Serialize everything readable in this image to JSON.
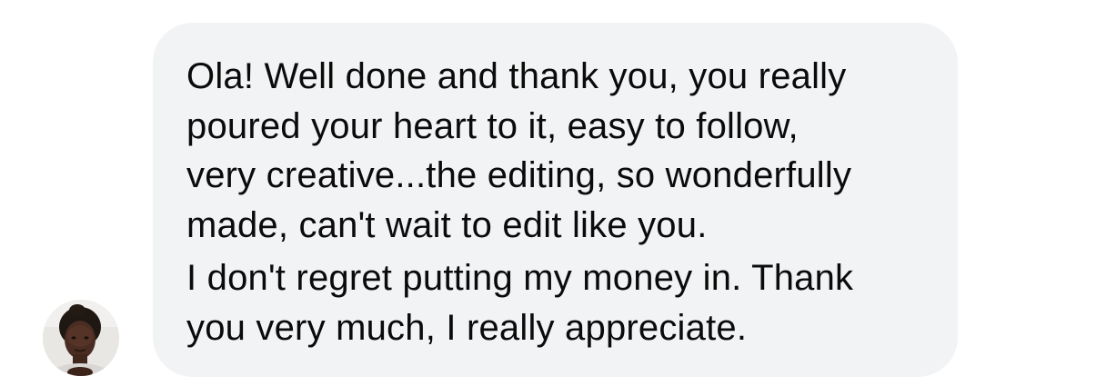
{
  "message": {
    "paragraphs": [
      "Ola! Well done and thank you, you really\npoured your heart to it, easy to follow,\nvery creative...the editing, so wonderfully\nmade, can't wait to edit like you.",
      "I don't regret putting my money in. Thank\nyou very much, I really appreciate."
    ]
  },
  "colors": {
    "bubble_background": "#f2f3f5",
    "text": "#0b0b0b",
    "page_background": "#ffffff"
  },
  "icons": {
    "avatar": "sender-avatar-photo"
  }
}
